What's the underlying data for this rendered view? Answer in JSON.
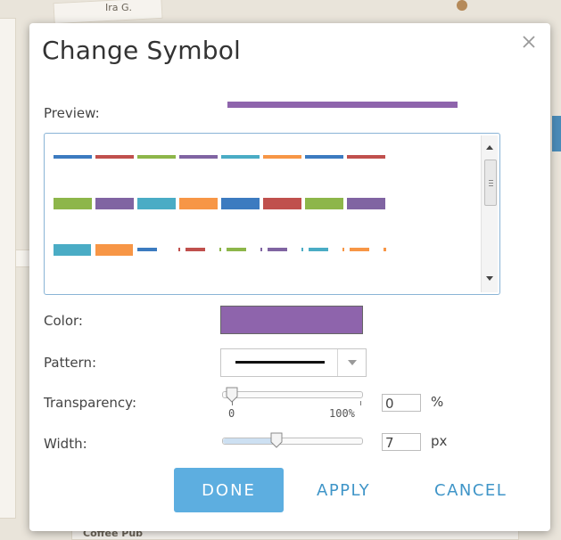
{
  "map": {
    "labels": [
      "Ira G.",
      "Coffee Pub",
      "Ira G."
    ],
    "poi_color": "#b58a5a"
  },
  "dialog": {
    "title": "Change Symbol",
    "close_icon": "close-icon",
    "preview_label": "Preview:",
    "preview_color": "#8e64ac",
    "gallery": {
      "rows": [
        {
          "style": "thin-solid",
          "colors": [
            "#3c7bc0",
            "#c0504d",
            "#8db64a",
            "#8064a2",
            "#4aacc5",
            "#f79646",
            "#3c7bc0",
            "#c0504d"
          ]
        },
        {
          "style": "medium-solid",
          "colors": [
            "#8db64a",
            "#8064a2",
            "#4aacc5",
            "#f79646",
            "#3c7bc0",
            "#c0504d",
            "#8db64a",
            "#8064a2"
          ]
        },
        {
          "style": "thick-then-dashdot",
          "colors": [
            "#4aacc5",
            "#f79646",
            "#3c7bc0",
            "#c0504d",
            "#8db64a",
            "#8064a2",
            "#4aacc5",
            "#f79646"
          ]
        }
      ]
    },
    "color_label": "Color:",
    "color_value": "#8e64ac",
    "pattern_label": "Pattern:",
    "pattern_value": "solid",
    "transparency_label": "Transparency:",
    "transparency": {
      "min_label": "0",
      "max_label": "100%",
      "value": "0",
      "unit": "%",
      "fraction": 0
    },
    "width_label": "Width:",
    "width": {
      "value": "7",
      "unit": "px",
      "fraction": 0.4
    },
    "buttons": {
      "done": "DONE",
      "apply": "APPLY",
      "cancel": "CANCEL"
    },
    "accent_color": "#5daee0"
  }
}
